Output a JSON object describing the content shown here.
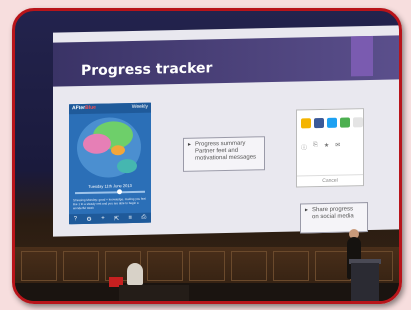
{
  "slide": {
    "title": "Progress tracker",
    "phone": {
      "app_name_prefix": "AFter",
      "app_name_highlight": "Blue",
      "status": "Weekly",
      "date": "Tuesday 11th June 2013",
      "message": "Stressing Monday: good + knowledge, making you feel like 1 to a steady rest and you are able to begin a wonderful week",
      "nav_icons": [
        "?",
        "⚙",
        "+",
        "⇱",
        "≡",
        "⎙"
      ]
    },
    "callout_left": {
      "lines": [
        "Progress summary",
        "Partner feet and motivational messages"
      ]
    },
    "callout_right": {
      "lines": [
        "Share progress",
        "on social media"
      ]
    },
    "social": {
      "icon_colors": [
        "#f4b400",
        "#3b5998",
        "#1da1f2",
        "#4caf50",
        "#e4e4e4"
      ],
      "row2_glyphs": [
        "ⓘ",
        "⎘",
        "★",
        "✉"
      ],
      "cancel_label": "Cancel"
    }
  },
  "colors": {
    "frame_border": "#b8141a",
    "slide_band": "#3a3366",
    "background": "#f7dede"
  }
}
